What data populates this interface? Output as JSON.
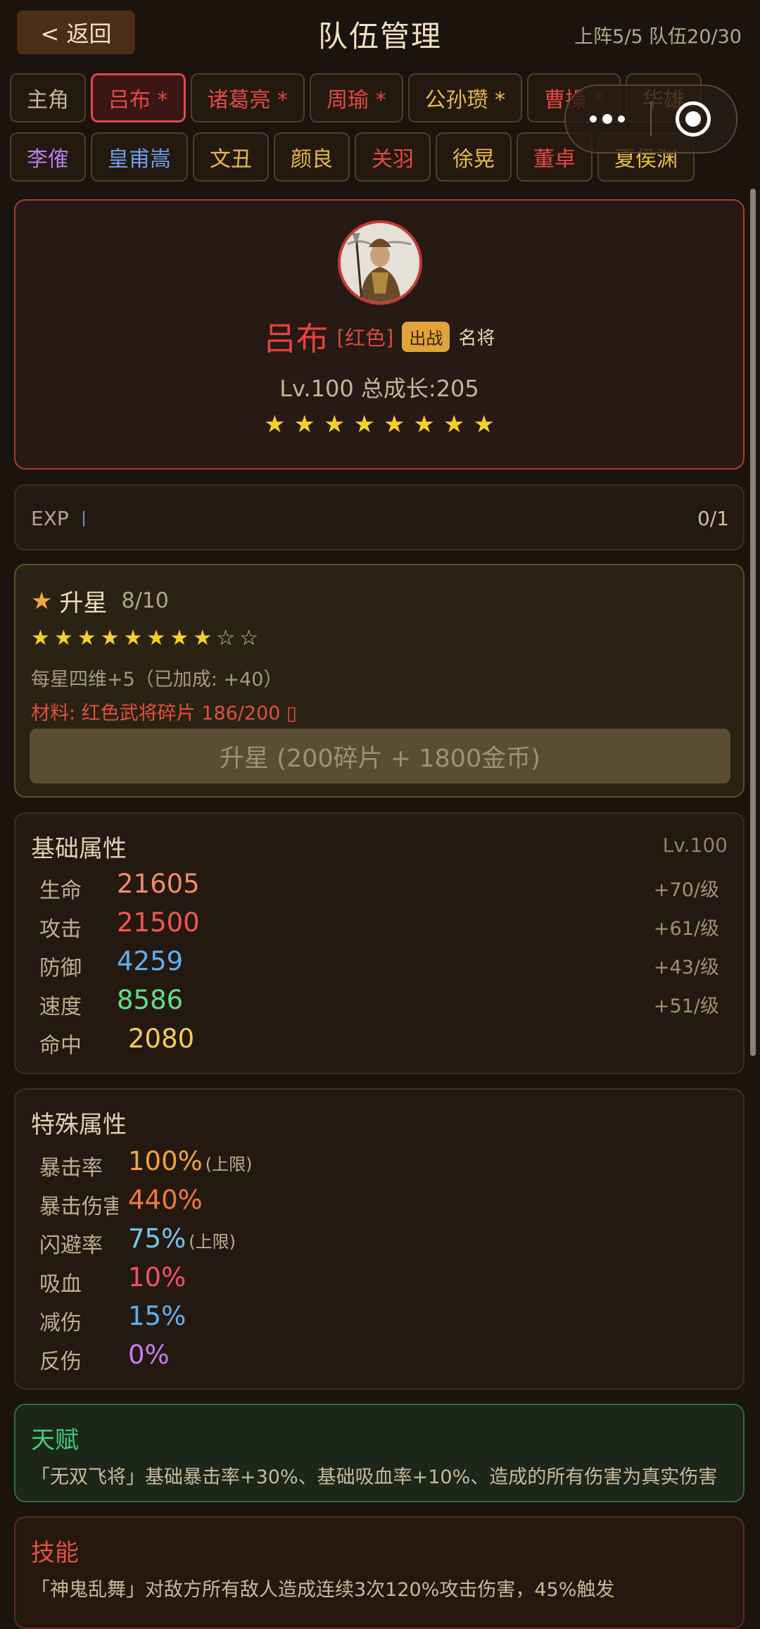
{
  "header": {
    "back_label": "< 返回",
    "title": "队伍管理",
    "team_status": "上阵5/5 队伍20/30"
  },
  "tabs_row1": [
    {
      "label": "主角",
      "color": "gray"
    },
    {
      "label": "吕布 *",
      "color": "red",
      "active": true
    },
    {
      "label": "诸葛亮 *",
      "color": "red"
    },
    {
      "label": "周瑜 *",
      "color": "red"
    },
    {
      "label": "公孙瓒 *",
      "color": "gold"
    },
    {
      "label": "曹操 *",
      "color": "red"
    },
    {
      "label": "华雄",
      "color": "gold"
    }
  ],
  "tabs_row2": [
    {
      "label": "李傕",
      "color": "purple"
    },
    {
      "label": "皇甫嵩",
      "color": "blue"
    },
    {
      "label": "文丑",
      "color": "gold"
    },
    {
      "label": "颜良",
      "color": "gold"
    },
    {
      "label": "关羽",
      "color": "red"
    },
    {
      "label": "徐晃",
      "color": "gold"
    },
    {
      "label": "董卓",
      "color": "red"
    },
    {
      "label": "夏侯渊",
      "color": "gold"
    }
  ],
  "hero": {
    "name": "吕布",
    "rarity": "[红色]",
    "deploy_badge": "出战",
    "title": "名将",
    "level_text": "Lv.100  总成长:205",
    "stars_count": 8
  },
  "exp": {
    "label": "EXP",
    "value": "0/1",
    "progress": 0
  },
  "star_up": {
    "title": "升星",
    "progress": "8/10",
    "filled": 8,
    "total": 10,
    "bonus_text": "每星四维+5（已加成: +40）",
    "material_text": "材料: 红色武将碎片 186/200 ▯",
    "button_label": "升星 (200碎片 + 1800金币)"
  },
  "base_attributes": {
    "title": "基础属性",
    "level": "Lv.100",
    "rows": [
      {
        "label": "生命",
        "value": "21605",
        "growth": "+70/级",
        "color": "#f08a6b"
      },
      {
        "label": "攻击",
        "value": "21500",
        "growth": "+61/级",
        "color": "#f05a4f"
      },
      {
        "label": "防御",
        "value": "4259",
        "growth": "+43/级",
        "color": "#5fb0f0"
      },
      {
        "label": "速度",
        "value": "8586",
        "growth": "+51/级",
        "color": "#5fe08a"
      },
      {
        "label": "命中",
        "value": "2080",
        "growth": "",
        "color": "#f2cd55"
      }
    ]
  },
  "special_attributes": {
    "title": "特殊属性",
    "rows": [
      {
        "label": "暴击率",
        "value": "100%",
        "cap": "(上限)",
        "color": "#f2a23b"
      },
      {
        "label": "暴击伤害",
        "value": "440%",
        "cap": "",
        "color": "#f07a3b"
      },
      {
        "label": "闪避率",
        "value": "75%",
        "cap": "(上限)",
        "color": "#6ec8f0"
      },
      {
        "label": "吸血",
        "value": "10%",
        "cap": "",
        "color": "#f0506e"
      },
      {
        "label": "减伤",
        "value": "15%",
        "cap": "",
        "color": "#5fb0f0"
      },
      {
        "label": "反伤",
        "value": "0%",
        "cap": "",
        "color": "#c77df0"
      }
    ]
  },
  "talent": {
    "title": "天赋",
    "description": "「无双飞将」基础暴击率+30%、基础吸血率+10%、造成的所有伤害为真实伤害"
  },
  "skill": {
    "title": "技能",
    "description": "「神鬼乱舞」对敌方所有敌人造成连续3次120%攻击伤害，45%触发"
  },
  "colors": {
    "accent_red": "#e3474a",
    "gold": "#e1a43a",
    "star": "#f6cf2a"
  }
}
